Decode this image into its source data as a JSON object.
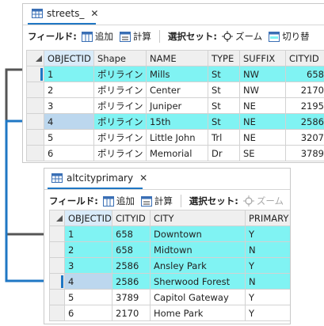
{
  "streets": {
    "tab_title": "streets_",
    "close_glyph": "✕",
    "toolbar": {
      "field_label": "フィールド:",
      "add_label": "追加",
      "calc_label": "計算",
      "selection_label": "選択セット:",
      "zoom_label": "ズーム",
      "switch_label": "切り替"
    },
    "columns": [
      "OBJECTID",
      "Shape",
      "NAME",
      "TYPE",
      "SUFFIX",
      "CITYID"
    ],
    "rows": [
      {
        "objectid": "1",
        "shape": "ポリライン",
        "name": "Mills",
        "type": "St",
        "suffix": "NW",
        "cityid": "658"
      },
      {
        "objectid": "2",
        "shape": "ポリライン",
        "name": "Center",
        "type": "St",
        "suffix": "NW",
        "cityid": "2170"
      },
      {
        "objectid": "3",
        "shape": "ポリライン",
        "name": "Juniper",
        "type": "St",
        "suffix": "NE",
        "cityid": "2195"
      },
      {
        "objectid": "4",
        "shape": "ポリライン",
        "name": "15th",
        "type": "St",
        "suffix": "NE",
        "cityid": "2586"
      },
      {
        "objectid": "5",
        "shape": "ポリライン",
        "name": "Little John",
        "type": "Trl",
        "suffix": "NE",
        "cityid": "3207"
      },
      {
        "objectid": "6",
        "shape": "ポリライン",
        "name": "Memorial",
        "type": "Dr",
        "suffix": "SE",
        "cityid": "3789"
      }
    ]
  },
  "altcity": {
    "tab_title": "altcityprimary",
    "close_glyph": "✕",
    "toolbar": {
      "field_label": "フィールド:",
      "add_label": "追加",
      "calc_label": "計算",
      "selection_label": "選択セット:",
      "zoom_label": "ズーム"
    },
    "columns": [
      "OBJECTID",
      "CITYID",
      "CITY",
      "PRIMARY"
    ],
    "rows": [
      {
        "objectid": "1",
        "cityid": "658",
        "city": "Downtown",
        "primary": "Y"
      },
      {
        "objectid": "2",
        "cityid": "658",
        "city": "Midtown",
        "primary": "N"
      },
      {
        "objectid": "3",
        "cityid": "2586",
        "city": "Ansley Park",
        "primary": "Y"
      },
      {
        "objectid": "4",
        "cityid": "2586",
        "city": "Sherwood Forest",
        "primary": "N"
      },
      {
        "objectid": "5",
        "cityid": "3789",
        "city": "Capitol Gateway",
        "primary": "Y"
      },
      {
        "objectid": "6",
        "cityid": "2170",
        "city": "Home Park",
        "primary": "Y"
      }
    ]
  },
  "colors": {
    "highlight": "#80f3f3",
    "current_cell": "#bcd7ee",
    "accent": "#1f77c4",
    "connector_gray": "#555555"
  },
  "icons": [
    "table-icon",
    "add-field-icon",
    "calculate-field-icon",
    "zoom-selection-icon",
    "switch-selection-icon",
    "sort-triangle-icon"
  ]
}
